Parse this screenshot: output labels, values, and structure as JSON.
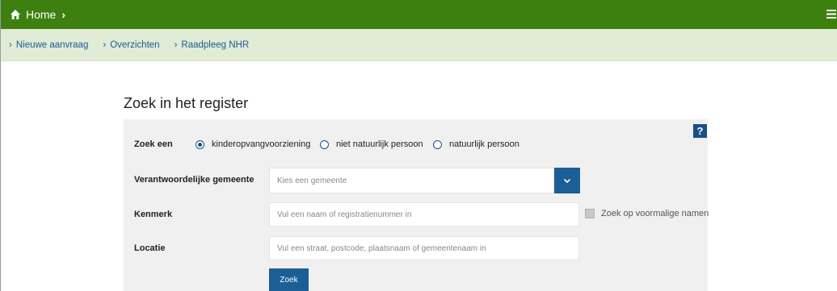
{
  "topbar": {
    "home_label": "Home"
  },
  "subnav": {
    "items": [
      {
        "label": "Nieuwe aanvraag"
      },
      {
        "label": "Overzichten"
      },
      {
        "label": "Raadpleeg NHR"
      }
    ]
  },
  "page": {
    "title": "Zoek in het register"
  },
  "form": {
    "help_label": "?",
    "zoek_een": {
      "label": "Zoek een",
      "options": [
        {
          "label": "kinderopvangvoorziening",
          "selected": true
        },
        {
          "label": "niet natuurlijk persoon",
          "selected": false
        },
        {
          "label": "natuurlijk persoon",
          "selected": false
        }
      ]
    },
    "gemeente": {
      "label": "Verantwoordelijke gemeente",
      "placeholder": "Kies een gemeente"
    },
    "kenmerk": {
      "label": "Kenmerk",
      "placeholder": "Vul een naam of registratienummer in"
    },
    "voormalige": {
      "label": "Zoek op voormalige namen",
      "checked": false
    },
    "locatie": {
      "label": "Locatie",
      "placeholder": "Vul een straat, postcode, plaatsnaam of gemeentenaam in"
    },
    "submit_label": "Zoek"
  },
  "colors": {
    "topbar": "#3d8010",
    "subnav": "#e0ecd6",
    "primary_button": "#1c5f96",
    "link": "#1d5a90"
  },
  "icons": [
    "home-icon",
    "chevron-right-icon",
    "hamburger-menu-icon",
    "chevron-down-icon",
    "help-icon"
  ]
}
